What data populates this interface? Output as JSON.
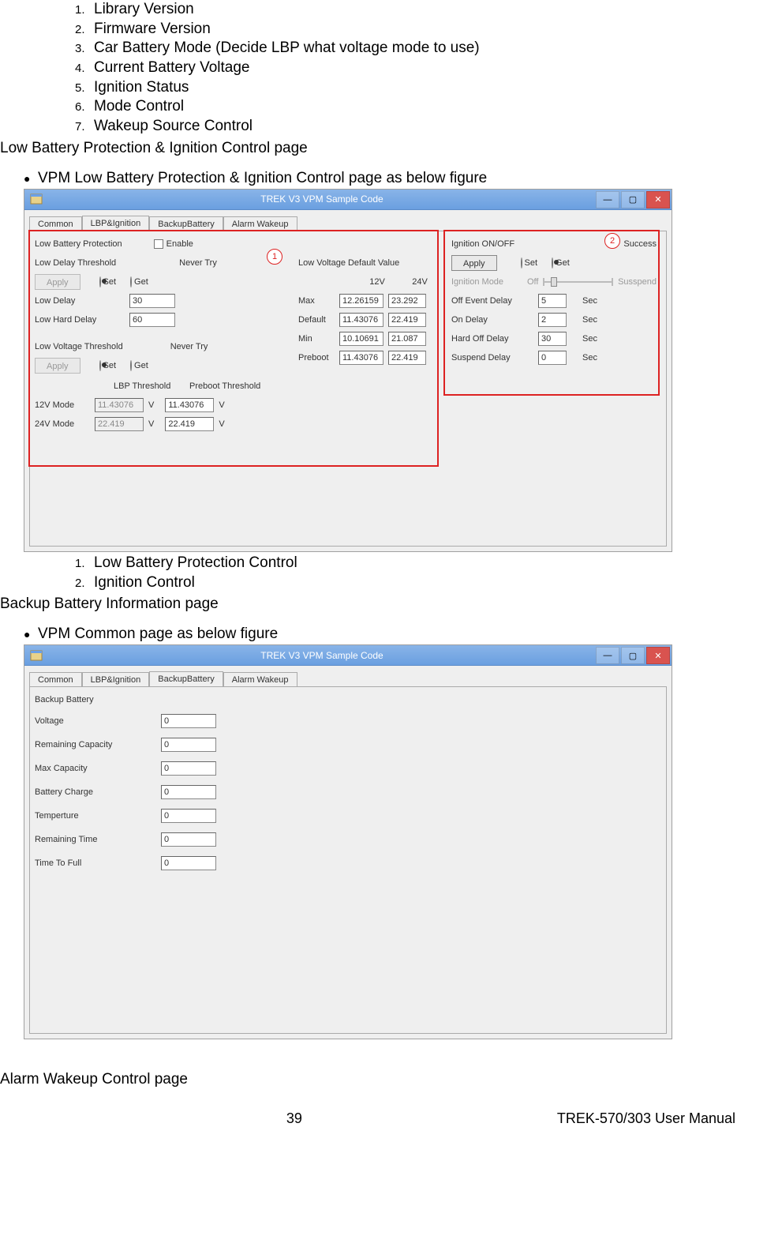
{
  "topList": [
    {
      "n": "1.",
      "t": "Library Version"
    },
    {
      "n": "2.",
      "t": "Firmware Version"
    },
    {
      "n": "3.",
      "t": "Car Battery Mode (Decide LBP what voltage mode to use)"
    },
    {
      "n": "4.",
      "t": "Current Battery Voltage"
    },
    {
      "n": "5.",
      "t": "Ignition Status"
    },
    {
      "n": "6.",
      "t": "Mode Control"
    },
    {
      "n": "7.",
      "t": "Wakeup Source Control"
    }
  ],
  "section1": "Low Battery Protection & Ignition Control page",
  "bullet1": "VPM Low Battery Protection & Ignition Control page as below figure",
  "list1": [
    {
      "n": "1.",
      "t": "Low Battery Protection Control"
    },
    {
      "n": "2.",
      "t": "Ignition Control"
    }
  ],
  "section2": "Backup Battery Information page",
  "bullet2": "VPM Common page as below figure",
  "section3": "Alarm Wakeup Control page",
  "footer": {
    "page": "39",
    "doc": "TREK-570/303 User Manual"
  },
  "ss1": {
    "title": "TREK V3 VPM Sample Code",
    "tabs": [
      "Common",
      "LBP&Ignition",
      "BackupBattery",
      "Alarm Wakeup"
    ],
    "activeTab": 1,
    "callout1": "1",
    "callout2": "2",
    "labels": {
      "lbp": "Low Battery Protection",
      "enable": "Enable",
      "ldt": "Low Delay Threshold",
      "neverTry": "Never Try",
      "apply": "Apply",
      "set": "Set",
      "get": "Get",
      "lowDelay": "Low Delay",
      "lowHardDelay": "Low Hard Delay",
      "lvt": "Low Voltage Threshold",
      "lbpTh": "LBP Threshold",
      "prebootTh": "Preboot Threshold",
      "m12": "12V Mode",
      "m24": "24V Mode",
      "V": "V",
      "lvdv": "Low Voltage Default Value",
      "c12": "12V",
      "c24": "24V",
      "max": "Max",
      "def": "Default",
      "min": "Min",
      "preboot": "Preboot",
      "ign": "Ignition ON/OFF",
      "success": "Success",
      "ignMode": "Ignition Mode",
      "off": "Off",
      "susp": "Susspend",
      "offEvt": "Off Event Delay",
      "onDelay": "On Delay",
      "hardOff": "Hard Off Delay",
      "suspDelay": "Suspend Delay",
      "sec": "Sec"
    },
    "values": {
      "lowDelay": "30",
      "lowHardDelay": "60",
      "lbp12": "11.43076",
      "lbp24": "22.419",
      "pre12": "11.43076",
      "pre24": "22.419",
      "max12": "12.26159",
      "max24": "23.292",
      "def12": "11.43076",
      "def24": "22.419",
      "min12": "10.10691",
      "min24": "21.087",
      "prb12": "11.43076",
      "prb24": "22.419",
      "offEvt": "5",
      "onDelay": "2",
      "hardOff": "30",
      "suspDelay": "0"
    }
  },
  "ss2": {
    "title": "TREK V3 VPM Sample Code",
    "tabs": [
      "Common",
      "LBP&Ignition",
      "BackupBattery",
      "Alarm Wakeup"
    ],
    "activeTab": 2,
    "labels": {
      "hdr": "Backup Battery",
      "volt": "Voltage",
      "rem": "Remaining Capacity",
      "max": "Max Capacity",
      "chg": "Battery Charge",
      "temp": "Temperture",
      "rtime": "Remaining Time",
      "ttf": "Time To Full"
    },
    "values": {
      "volt": "0",
      "rem": "0",
      "max": "0",
      "chg": "0",
      "temp": "0",
      "rtime": "0",
      "ttf": "0"
    }
  }
}
